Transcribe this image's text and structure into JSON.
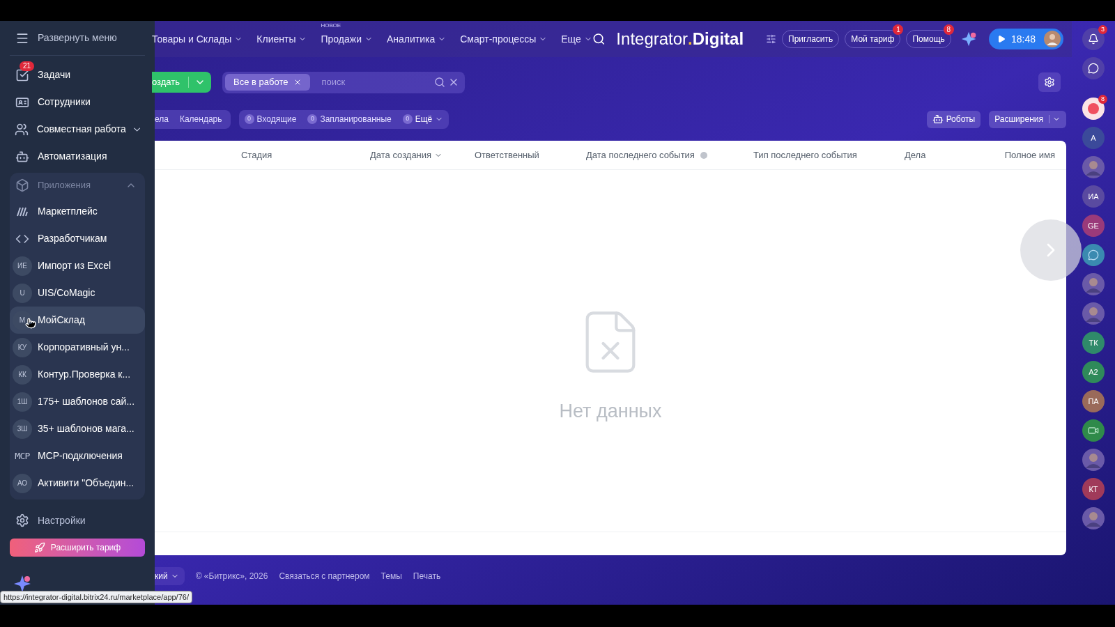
{
  "sidebar": {
    "toggle": "Развернуть меню",
    "items": [
      {
        "kind": "icon",
        "label": "Задачи",
        "badge": "21",
        "dropdown": false,
        "hovered": false
      },
      {
        "kind": "icon",
        "label": "Сотрудники",
        "dropdown": false,
        "hovered": false
      },
      {
        "kind": "icon",
        "label": "Совместная работа",
        "dropdown": true,
        "hovered": false
      },
      {
        "kind": "icon",
        "label": "Автоматизация",
        "dropdown": false,
        "hovered": false
      }
    ],
    "apps": {
      "label": "Приложения",
      "expanded": true,
      "items": [
        {
          "kind": "icon",
          "label": "Маркетплейс",
          "hovered": false
        },
        {
          "kind": "icon",
          "label": "Разработчикам",
          "hovered": false
        },
        {
          "kind": "initials",
          "initials": "ИЕ",
          "label": "Импорт из Excel",
          "hovered": false
        },
        {
          "kind": "initials",
          "initials": "U",
          "label": "UIS/CoMagic",
          "hovered": false
        },
        {
          "kind": "initials",
          "initials": "М",
          "label": "МойСклад",
          "hovered": true
        },
        {
          "kind": "initials",
          "initials": "КУ",
          "label": "Корпоративный ун...",
          "hovered": false
        },
        {
          "kind": "initials",
          "initials": "КК",
          "label": "Контур.Проверка к...",
          "hovered": false
        },
        {
          "kind": "initials",
          "initials": "1Ш",
          "label": "175+ шаблонов сай...",
          "hovered": false
        },
        {
          "kind": "initials",
          "initials": "3Ш",
          "label": "35+ шаблонов мага...",
          "hovered": false
        },
        {
          "kind": "mono",
          "initials": "MCP",
          "label": "MCP-подключения",
          "hovered": false
        },
        {
          "kind": "initials",
          "initials": "АО",
          "label": "Активити \"Объедин...",
          "hovered": false
        }
      ]
    },
    "settings": "Настройки",
    "upgrade": "Расширить тариф"
  },
  "nav": {
    "items": [
      {
        "label": "Товары и Склады"
      },
      {
        "label": "Клиенты"
      },
      {
        "label": "Продажи",
        "tag": "НОВОЕ"
      },
      {
        "label": "Аналитика"
      },
      {
        "label": "Смарт-процессы"
      },
      {
        "label": "Еще"
      }
    ],
    "logo_a": "Integrator",
    "logo_dot": ".",
    "logo_b": "Digital",
    "buttons": [
      {
        "label": "Пригласить"
      },
      {
        "label": "Мой тариф",
        "badge": "1"
      },
      {
        "label": "Помощь",
        "badge": "8"
      }
    ],
    "time": "18:48"
  },
  "toolbar": {
    "create": "оздать",
    "filter_chip": "Все в работе",
    "search": {
      "placeholder": "поиск"
    }
  },
  "views": {
    "tabs": [
      "ела",
      "Календарь"
    ],
    "counters": [
      {
        "count": "0",
        "label": "Входящие"
      },
      {
        "count": "0",
        "label": "Запланированные"
      },
      {
        "count": "0",
        "label": "Ещё"
      }
    ],
    "robots": "Роботы",
    "extensions": "Расширения"
  },
  "table": {
    "columns": [
      {
        "label": "Стадия",
        "sort": false,
        "info": false
      },
      {
        "label": "Дата создания",
        "sort": true,
        "info": false
      },
      {
        "label": "Ответственный",
        "sort": false,
        "info": false
      },
      {
        "label": "Дата последнего события",
        "sort": false,
        "info": true
      },
      {
        "label": "Тип последнего события",
        "sort": false,
        "info": false
      },
      {
        "label": "Дела",
        "sort": false,
        "info": false
      },
      {
        "label": "Полное имя",
        "sort": false,
        "info": false
      }
    ],
    "empty": "Нет данных"
  },
  "footer": {
    "language": "кий",
    "links": [
      "© «Битрикс», 2026",
      "Связаться с партнером",
      "Темы",
      "Печать"
    ]
  },
  "right_rail": {
    "notifications_badge": "3",
    "alert_badge": "8",
    "contacts": [
      {
        "kind": "initials",
        "initials": "А",
        "color": "#3b4a9a"
      },
      {
        "kind": "photo"
      },
      {
        "kind": "initials",
        "initials": "ИА",
        "color": "#5a4aa0"
      },
      {
        "kind": "initials",
        "initials": "GE",
        "color": "#9a3a7a"
      },
      {
        "kind": "chat",
        "color": "#3a8ab0"
      },
      {
        "kind": "photo"
      },
      {
        "kind": "photo"
      },
      {
        "kind": "initials",
        "initials": "ТК",
        "color": "#2f8a6a"
      },
      {
        "kind": "initials",
        "initials": "А2",
        "color": "#2f8a5a"
      },
      {
        "kind": "initials",
        "initials": "ПА",
        "color": "#9a6a5a"
      },
      {
        "kind": "video",
        "color": "#2f8a4a"
      },
      {
        "kind": "photo"
      },
      {
        "kind": "initials",
        "initials": "КТ",
        "color": "#a03a5a"
      },
      {
        "kind": "photo"
      }
    ]
  },
  "status_url": "https://integrator-digital.bitrix24.ru/marketplace/app/76/"
}
